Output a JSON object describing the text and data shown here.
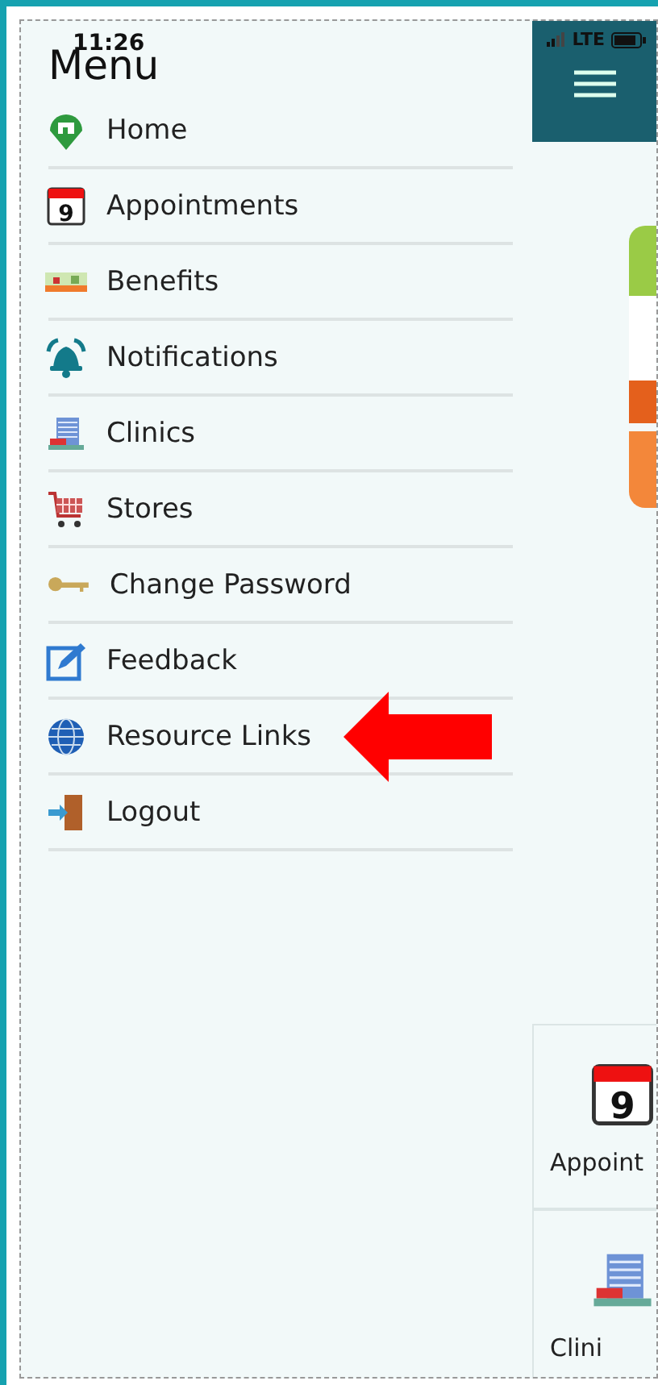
{
  "status_bar": {
    "time": "11:26",
    "network": "LTE"
  },
  "menu": {
    "title": "Menu",
    "items": [
      {
        "kind": "home",
        "label": "Home",
        "pointed": false
      },
      {
        "kind": "calendar",
        "label": "Appointments",
        "day": "9",
        "pointed": false
      },
      {
        "kind": "benefits",
        "label": "Benefits",
        "pointed": false
      },
      {
        "kind": "bell",
        "label": "Notifications",
        "pointed": false
      },
      {
        "kind": "clinic",
        "label": "Clinics",
        "pointed": false
      },
      {
        "kind": "cart",
        "label": "Stores",
        "pointed": false
      },
      {
        "kind": "key",
        "label": "Change Password",
        "pointed": false
      },
      {
        "kind": "feedback",
        "label": "Feedback",
        "pointed": false
      },
      {
        "kind": "globe",
        "label": "Resource Links",
        "pointed": true
      },
      {
        "kind": "logout",
        "label": "Logout",
        "pointed": false
      }
    ]
  },
  "tiles": [
    {
      "kind": "calendar",
      "label": "Appoint",
      "day": "9"
    },
    {
      "kind": "clinic",
      "label": "Clini"
    }
  ]
}
